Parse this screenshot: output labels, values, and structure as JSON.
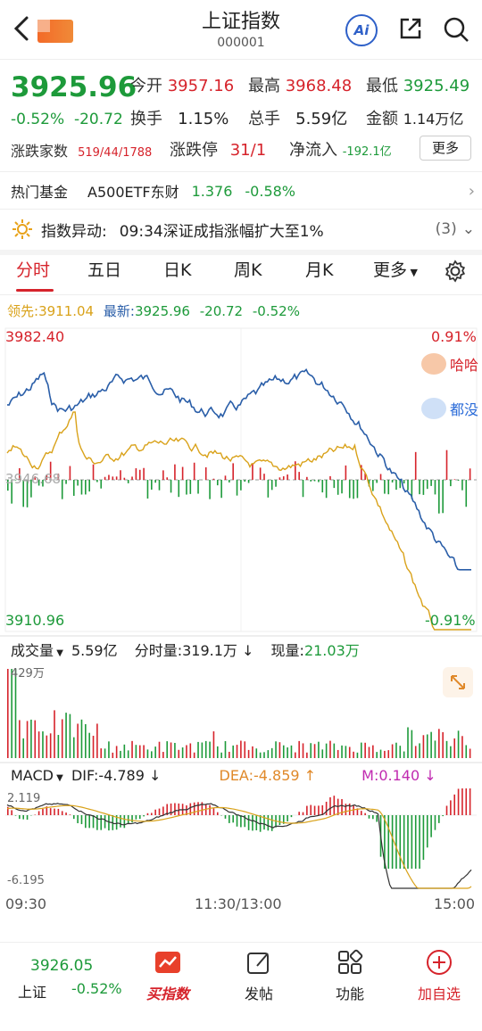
{
  "header": {
    "title": "上证指数",
    "code": "000001",
    "ai_label": "Ai"
  },
  "quote": {
    "price": "3925.96",
    "change_pct": "-0.52%",
    "change_abs": "-20.72",
    "open_label": "今开",
    "open": "3957.16",
    "high_label": "最高",
    "high": "3968.48",
    "low_label": "最低",
    "low": "3925.49",
    "turnover_label": "换手",
    "turnover": "1.15%",
    "total_hands_label": "总手",
    "total_hands": "5.59亿",
    "amount_label": "金额",
    "amount": "1.14万亿",
    "advdec_label": "涨跌家数",
    "advdec": "519/44/1788",
    "limit_label": "涨跌停",
    "limit": "31/1",
    "netflow_label": "净流入",
    "netflow": "-192.1亿",
    "more_label": "更多"
  },
  "hot_fund": {
    "label": "热门基金",
    "name": "A500ETF东财",
    "price": "1.376",
    "change": "-0.58%"
  },
  "alert": {
    "label": "指数异动:",
    "text": "09:34深证成指涨幅扩大至1%",
    "count": "(3)"
  },
  "tabs": [
    "分时",
    "五日",
    "日K",
    "周K",
    "月K",
    "更多"
  ],
  "intraday": {
    "lead_label": "领先:",
    "lead": "3911.04",
    "latest_label": "最新:",
    "latest": "3925.96",
    "latest_chg": "-20.72",
    "latest_pct": "-0.52%",
    "y_high": "3982.40",
    "y_mid": "3946.68",
    "y_low": "3910.96",
    "pct_high": "0.91%",
    "pct_low": "-0.91%",
    "badge1": "哈哈",
    "badge2": "都没"
  },
  "volume": {
    "label": "成交量",
    "total": "5.59亿",
    "minute_label": "分时量:",
    "minute": "319.1万",
    "current_label": "现量:",
    "current": "21.03万",
    "max_label": "429万"
  },
  "macd": {
    "label": "MACD",
    "dif_label": "DIF:",
    "dif": "-4.789",
    "dea_label": "DEA:",
    "dea": "-4.859",
    "m_label": "M:",
    "m": "0.140",
    "top": "2.119",
    "bottom": "-6.195"
  },
  "time_axis": [
    "09:30",
    "11:30/13:00",
    "15:00"
  ],
  "bottom_nav": {
    "price": "3926.05",
    "name": "上证",
    "pct": "-0.52%",
    "items": [
      "买指数",
      "发帖",
      "功能",
      "加自选"
    ]
  },
  "colors": {
    "up": "#d6232b",
    "down": "#1d9a3a",
    "price_line": "#2a5ea8",
    "avg_line": "#d9a21a"
  }
}
